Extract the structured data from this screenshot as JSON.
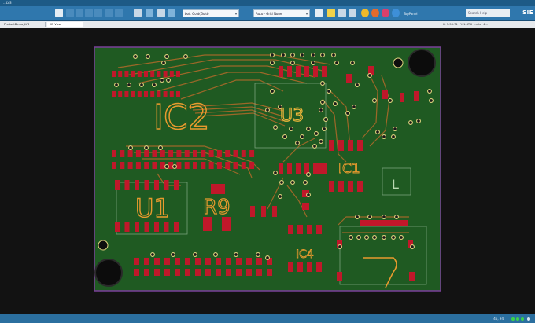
{
  "window": {
    "title": "...LYS"
  },
  "toolbar": {
    "layer_select": "bot. Gold(Gold)",
    "grid_select": "Auto - Grid None",
    "view_select": "TopPanel",
    "search_placeholder": "Search Help",
    "brand": "SIE"
  },
  "tabs": [
    {
      "label": "ProductDemo_LYS"
    },
    {
      "label": "2D View"
    }
  ],
  "coords_text": "X: 3-56.71 · Y: 1.4T.6 · mils · 4...",
  "status": {
    "zoom_text": "46, 94"
  },
  "board": {
    "labels": {
      "ic2": "IC2",
      "u3": "U3",
      "ic1": "IC1",
      "u1": "U1",
      "r9": "R9",
      "ic4": "IC4",
      "l": "L"
    },
    "colors": {
      "board_fill": "#1f5a22",
      "outline": "#7a3f9a",
      "copper": "#c0182a",
      "trace": "#b36a2a",
      "silk": "#e89a2e",
      "pad_ring": "#e3d680"
    }
  }
}
